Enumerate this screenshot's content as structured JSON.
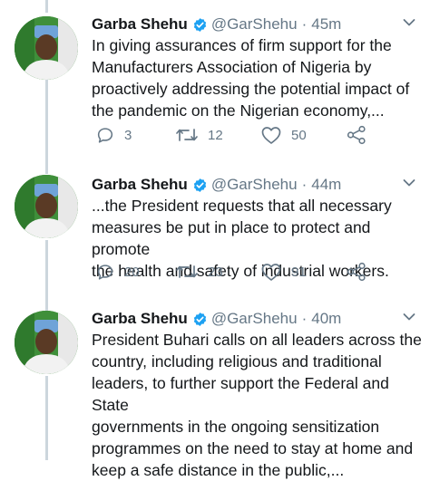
{
  "tweets": [
    {
      "name": "Garba Shehu",
      "handle": "@GarShehu",
      "separator": "·",
      "time": "45m",
      "text": "In giving assurances of firm support for the\nManufacturers Association of Nigeria by\nproactively addressing the potential impact of\nthe pandemic on the Nigerian economy,...",
      "replies": "3",
      "retweets": "12",
      "likes": "50"
    },
    {
      "name": "Garba Shehu",
      "handle": "@GarShehu",
      "separator": "·",
      "time": "44m",
      "text": "...the President requests that all necessary\nmeasures be put in place to protect and promote\nthe health and safety of industrial workers.",
      "replies": "20",
      "retweets": "23",
      "likes": "91"
    },
    {
      "name": "Garba Shehu",
      "handle": "@GarShehu",
      "separator": "·",
      "time": "40m",
      "text": "President Buhari calls on all leaders across the\ncountry, including religious and traditional\nleaders, to further support the Federal and State\ngovernments in the ongoing sensitization\nprogrammes on the need to stay at home and\nkeep a safe distance in the public,...",
      "replies": "",
      "retweets": "",
      "likes": ""
    }
  ],
  "colors": {
    "verified": "#1da1f2",
    "muted": "#657786",
    "thread": "#ccd6dd",
    "avatar_bg": "#3f8f3a"
  },
  "icons": [
    "verified-badge-icon",
    "chevron-down-icon",
    "reply-icon",
    "retweet-icon",
    "like-icon",
    "share-icon"
  ]
}
